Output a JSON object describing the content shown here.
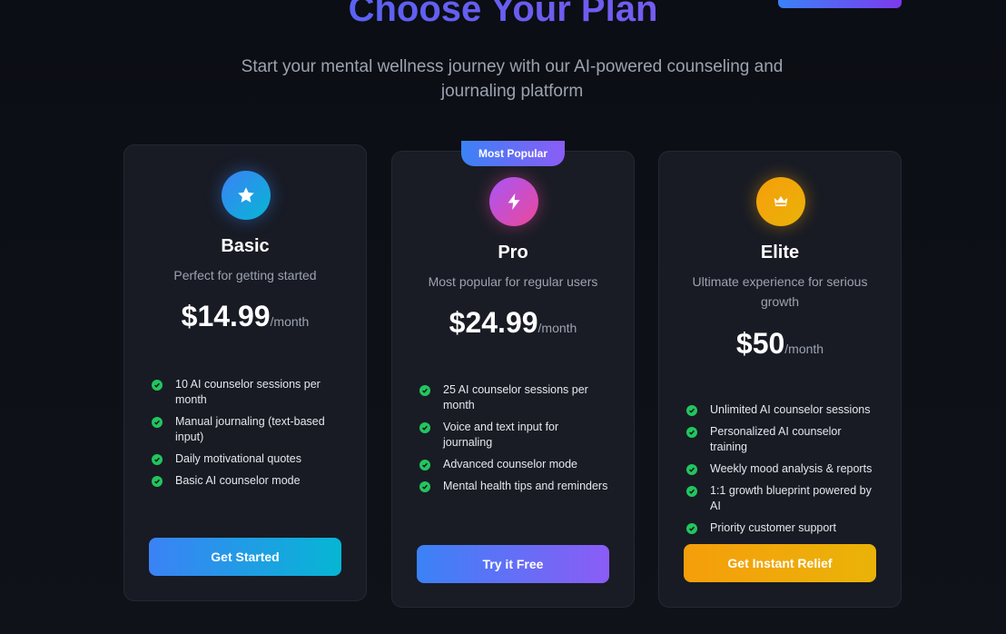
{
  "header": {
    "title": "Choose Your Plan",
    "subtitle": "Start your mental wellness journey with our AI-powered counseling and journaling platform"
  },
  "plans": [
    {
      "name": "Basic",
      "icon": "star-icon",
      "description": "Perfect for getting started",
      "price": "$14.99",
      "period": "/month",
      "features": [
        "10 AI counselor sessions per month",
        "Manual journaling (text-based input)",
        "Daily motivational quotes",
        "Basic AI counselor mode"
      ],
      "cta": "Get Started",
      "accent": "#3b82f6"
    },
    {
      "name": "Pro",
      "badge": "Most Popular",
      "icon": "lightning-icon",
      "description": "Most popular for regular users",
      "price": "$24.99",
      "period": "/month",
      "features": [
        "25 AI counselor sessions per month",
        "Voice and text input for journaling",
        "Advanced counselor mode",
        "Mental health tips and reminders"
      ],
      "cta": "Try it Free",
      "accent": "#8b5cf6"
    },
    {
      "name": "Elite",
      "icon": "crown-icon",
      "description": "Ultimate experience for serious growth",
      "price": "$50",
      "period": "/month",
      "features": [
        "Unlimited AI counselor sessions",
        "Personalized AI counselor training",
        "Weekly mood analysis & reports",
        "1:1 growth blueprint powered by AI",
        "Priority customer support"
      ],
      "cta": "Get Instant Relief",
      "accent": "#f59e0b"
    }
  ],
  "colors": {
    "background": "#0d1017",
    "card": "#181b24",
    "check": "#22c55e",
    "muted_text": "#9ca3af"
  }
}
